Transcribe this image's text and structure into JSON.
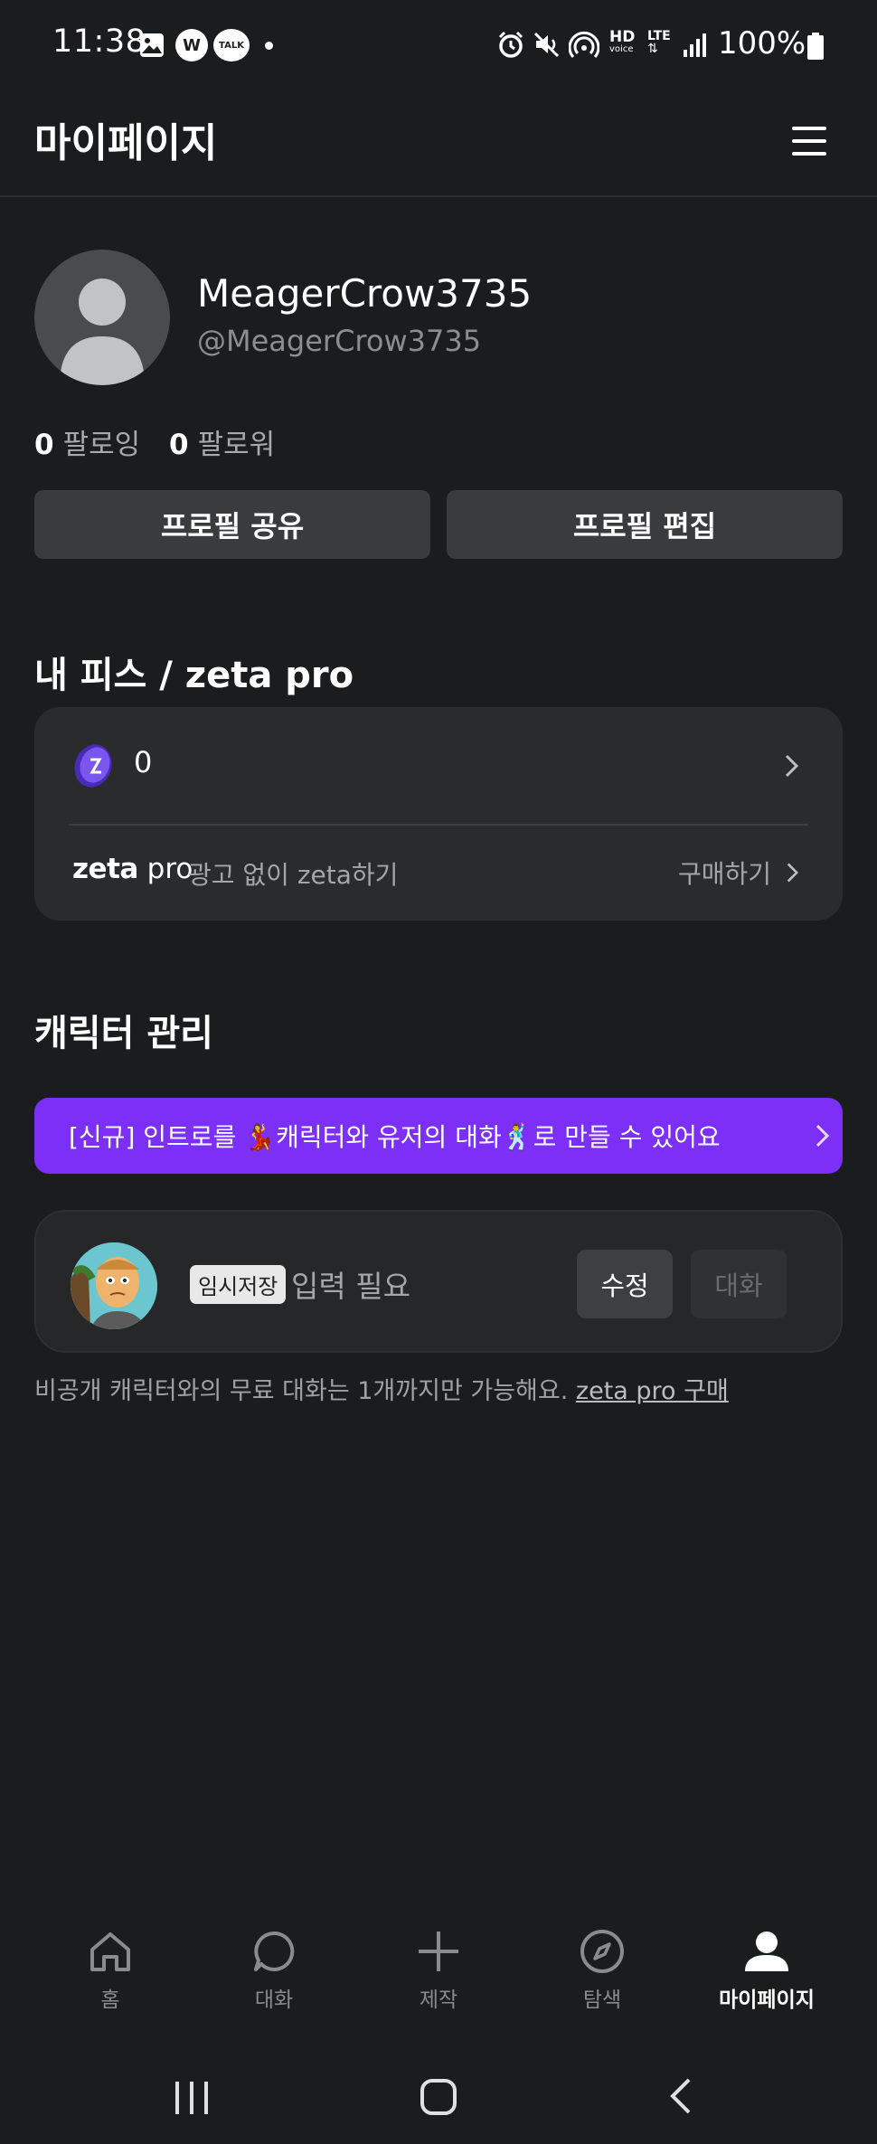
{
  "status_bar": {
    "time": "11:38",
    "battery": "100%",
    "icons": [
      "gallery-icon",
      "w-app-icon",
      "talk-icon",
      "dot-icon",
      "alarm-icon",
      "mute-icon",
      "hotspot-icon",
      "hd-voice-icon",
      "lte-icon",
      "signal-icon",
      "battery-icon"
    ],
    "hd_label": "HD",
    "voice_label": "voice",
    "lte_label": "LTE",
    "w_label": "W",
    "talk_label": "TALK"
  },
  "header": {
    "title": "마이페이지",
    "menu_icon": "hamburger-menu-icon"
  },
  "profile": {
    "username": "MeagerCrow3735",
    "handle": "@MeagerCrow3735",
    "following_count": "0",
    "following_label": "팔로잉",
    "followers_count": "0",
    "followers_label": "팔로워",
    "share_button": "프로필 공유",
    "edit_button": "프로필 편집"
  },
  "pis": {
    "section_title": "내 피스 / zeta pro",
    "coin_count": "0",
    "zeta_brand": "zeta",
    "pro_brand": "pro",
    "pro_description": "광고 없이 zeta하기",
    "buy_label": "구매하기"
  },
  "characters": {
    "section_title": "캐릭터 관리",
    "promo_text": "[신규] 인트로를 💃캐릭터와 유저의 대화🕺로 만들 수 있어요",
    "card": {
      "badge": "임시저장",
      "name": "입력 필요",
      "edit_button": "수정",
      "chat_button": "대화"
    },
    "footnote": "비공개 캐릭터와의 무료 대화는 1개까지만 가능해요.",
    "footnote_link": "zeta pro 구매"
  },
  "bottom_nav": {
    "items": [
      {
        "label": "홈",
        "icon": "home-icon"
      },
      {
        "label": "대화",
        "icon": "chat-bubble-icon"
      },
      {
        "label": "제작",
        "icon": "plus-icon"
      },
      {
        "label": "탐색",
        "icon": "compass-icon"
      },
      {
        "label": "마이페이지",
        "icon": "profile-icon"
      }
    ],
    "active_index": 4
  },
  "system_nav": {
    "icons": [
      "recent-apps-icon",
      "home-button-icon",
      "back-icon"
    ]
  },
  "colors": {
    "background": "#1b1c1d",
    "card": "#2a2b2d",
    "accent_purple": "#7b2ff7",
    "button_gray": "#3a3b3d"
  }
}
